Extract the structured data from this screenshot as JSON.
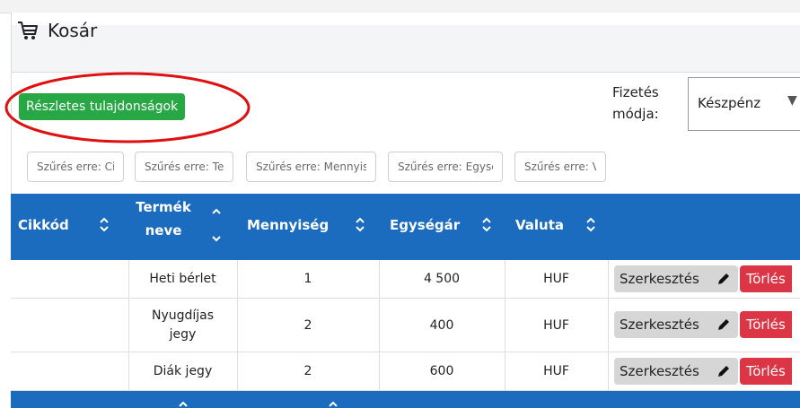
{
  "header": {
    "title": "Kosár",
    "icon": "cart-icon"
  },
  "toolbar": {
    "details_label": "Részletes tulajdonságok",
    "details_color": "#28a745"
  },
  "payment": {
    "label": "Fizetés módja:",
    "label_line1": "Fizetés",
    "label_line2": "módja:",
    "selected": "Készpénz"
  },
  "filters": [
    {
      "placeholder": "Szűrés erre: Cikkód"
    },
    {
      "placeholder": "Szűrés erre: Termék neve"
    },
    {
      "placeholder": "Szűrés erre: Mennyiség"
    },
    {
      "placeholder": "Szűrés erre: Egységár"
    },
    {
      "placeholder": "Szűrés erre: Valuta"
    }
  ],
  "table": {
    "header_color": "#1b6bbf",
    "columns": [
      {
        "line1": "Cikkód",
        "line2": ""
      },
      {
        "line1": "Termék",
        "line2": "neve"
      },
      {
        "line1": "Mennyiség",
        "line2": ""
      },
      {
        "line1": "Egységár",
        "line2": ""
      },
      {
        "line1": "Valuta",
        "line2": ""
      }
    ],
    "rows": [
      {
        "cikkod": "",
        "name_line1": "Heti bérlet",
        "name_line2": "",
        "qty": "1",
        "price": "4 500",
        "currency": "HUF"
      },
      {
        "cikkod": "",
        "name_line1": "Nyugdíjas",
        "name_line2": "jegy",
        "qty": "2",
        "price": "400",
        "currency": "HUF"
      },
      {
        "cikkod": "",
        "name_line1": "Diák jegy",
        "name_line2": "",
        "qty": "2",
        "price": "600",
        "currency": "HUF"
      }
    ],
    "edit_label": "Szerkesztés",
    "delete_label": "Törlés",
    "delete_color": "#dc3545"
  }
}
